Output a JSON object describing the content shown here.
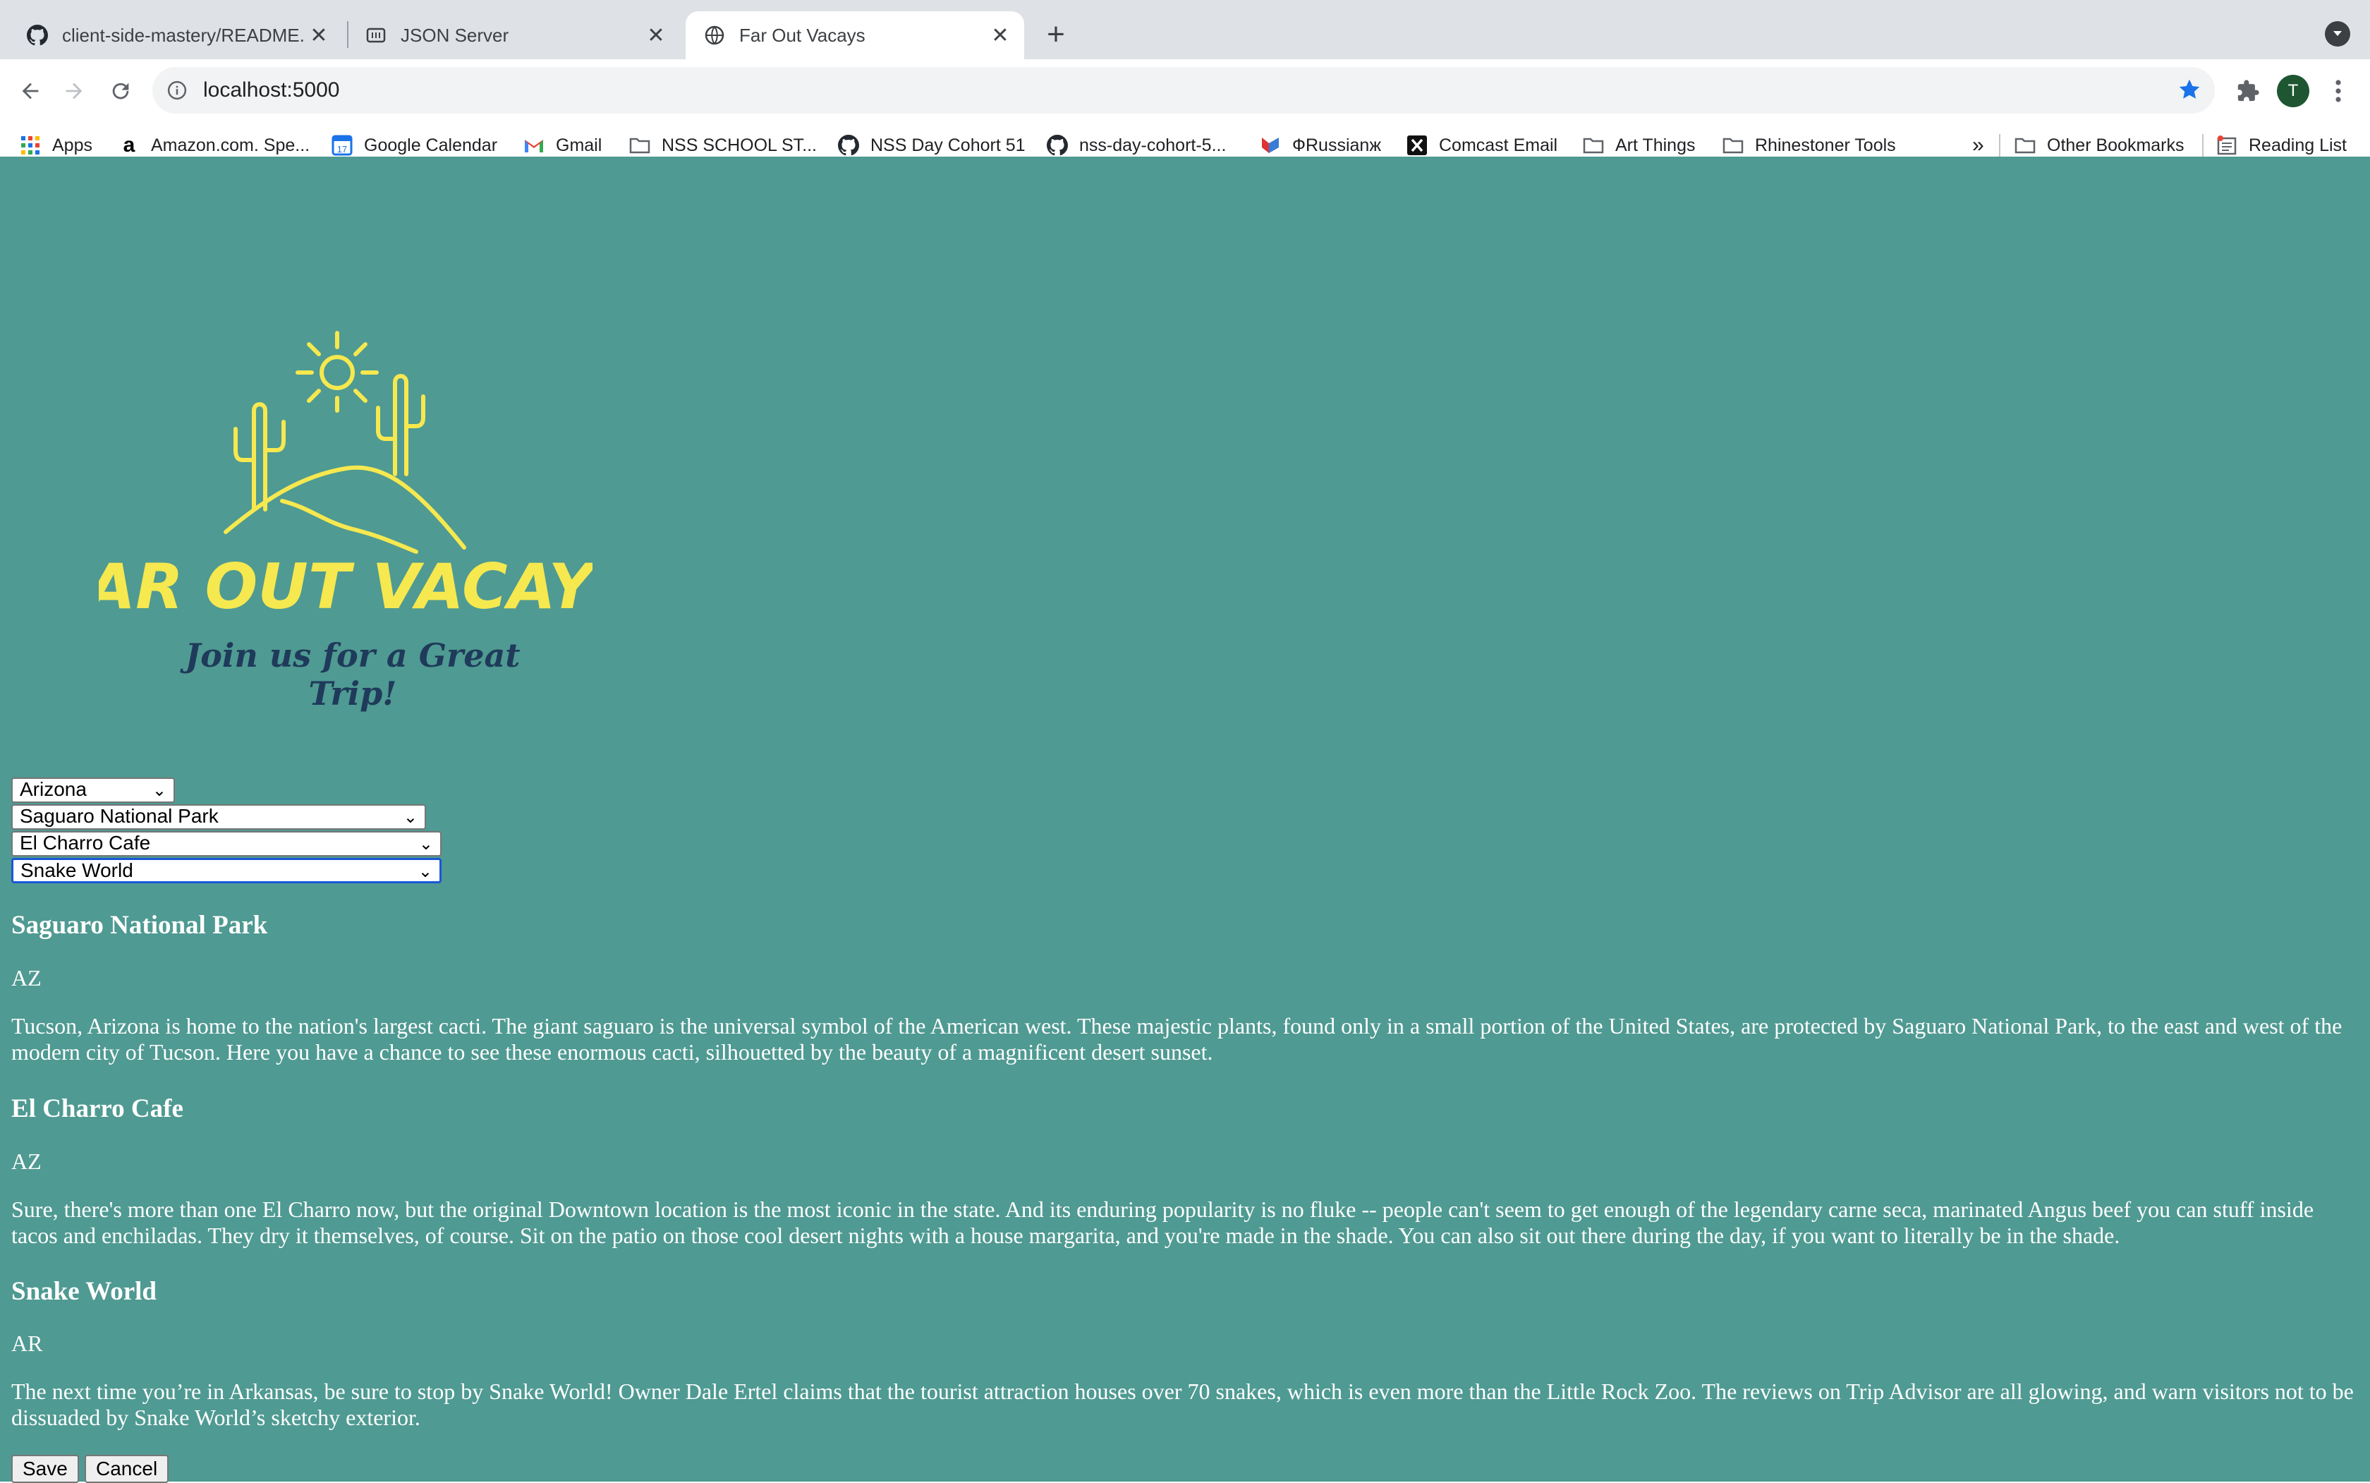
{
  "browser": {
    "tabs": [
      {
        "title": "client-side-mastery/README.m",
        "icon": "github-icon"
      },
      {
        "title": "JSON Server",
        "icon": "json-server-icon"
      },
      {
        "title": "Far Out Vacays",
        "icon": "globe-icon"
      }
    ],
    "url": "localhost:5000",
    "avatar_initial": "T",
    "bookmarks": [
      {
        "label": "Apps",
        "icon": "apps-grid-icon"
      },
      {
        "label": "Amazon.com. Spe...",
        "icon": "amazon-icon"
      },
      {
        "label": "Google Calendar",
        "icon": "calendar-icon"
      },
      {
        "label": "Gmail",
        "icon": "gmail-icon"
      },
      {
        "label": "NSS SCHOOL ST...",
        "icon": "folder-icon"
      },
      {
        "label": "NSS Day Cohort 51",
        "icon": "github-icon"
      },
      {
        "label": "nss-day-cohort-5...",
        "icon": "github-icon"
      },
      {
        "label": "ФRussianж",
        "icon": "russian-icon"
      },
      {
        "label": "Comcast Email",
        "icon": "comcast-icon"
      },
      {
        "label": "Art Things",
        "icon": "folder-icon"
      },
      {
        "label": "Rhinestoner Tools",
        "icon": "folder-icon"
      }
    ],
    "overflow_label": "»",
    "other_bookmarks": "Other Bookmarks",
    "reading_list": "Reading List"
  },
  "logo": {
    "title": "FAR OUT VACAYS",
    "tagline": "Join us for a Great Trip!",
    "colors": {
      "title": "#f6e84f",
      "tagline": "#1f3a5a"
    }
  },
  "selects": {
    "state": "Arizona",
    "park": "Saguaro National Park",
    "eatery": "El Charro Cafe",
    "attraction": "Snake World"
  },
  "itinerary": [
    {
      "name": "Saguaro National Park",
      "state": "AZ",
      "description": "Tucson, Arizona is home to the nation's largest cacti. The giant saguaro is the universal symbol of the American west. These majestic plants, found only in a small portion of the United States, are protected by Saguaro National Park, to the east and west of the modern city of Tucson. Here you have a chance to see these enormous cacti, silhouetted by the beauty of a magnificent desert sunset."
    },
    {
      "name": "El Charro Cafe",
      "state": "AZ",
      "description": "Sure, there's more than one El Charro now, but the original Downtown location is the most iconic in the state. And its enduring popularity is no fluke -- people can't seem to get enough of the legendary carne seca, marinated Angus beef you can stuff inside tacos and enchiladas. They dry it themselves, of course. Sit on the patio on those cool desert nights with a house margarita, and you're made in the shade. You can also sit out there during the day, if you want to literally be in the shade."
    },
    {
      "name": "Snake World",
      "state": "AR",
      "description": "The next time you’re in Arkansas, be sure to stop by Snake World! Owner Dale Ertel claims that the tourist attraction houses over 70 snakes, which is even more than the Little Rock Zoo. The reviews on Trip Advisor are all glowing, and warn visitors not to be dissuaded by Snake World’s sketchy exterior."
    }
  ],
  "buttons": {
    "save": "Save",
    "cancel": "Cancel"
  },
  "colors": {
    "page_background": "#4f9a92",
    "chrome_background": "#dee1e6",
    "accent": "#1a73e8"
  }
}
